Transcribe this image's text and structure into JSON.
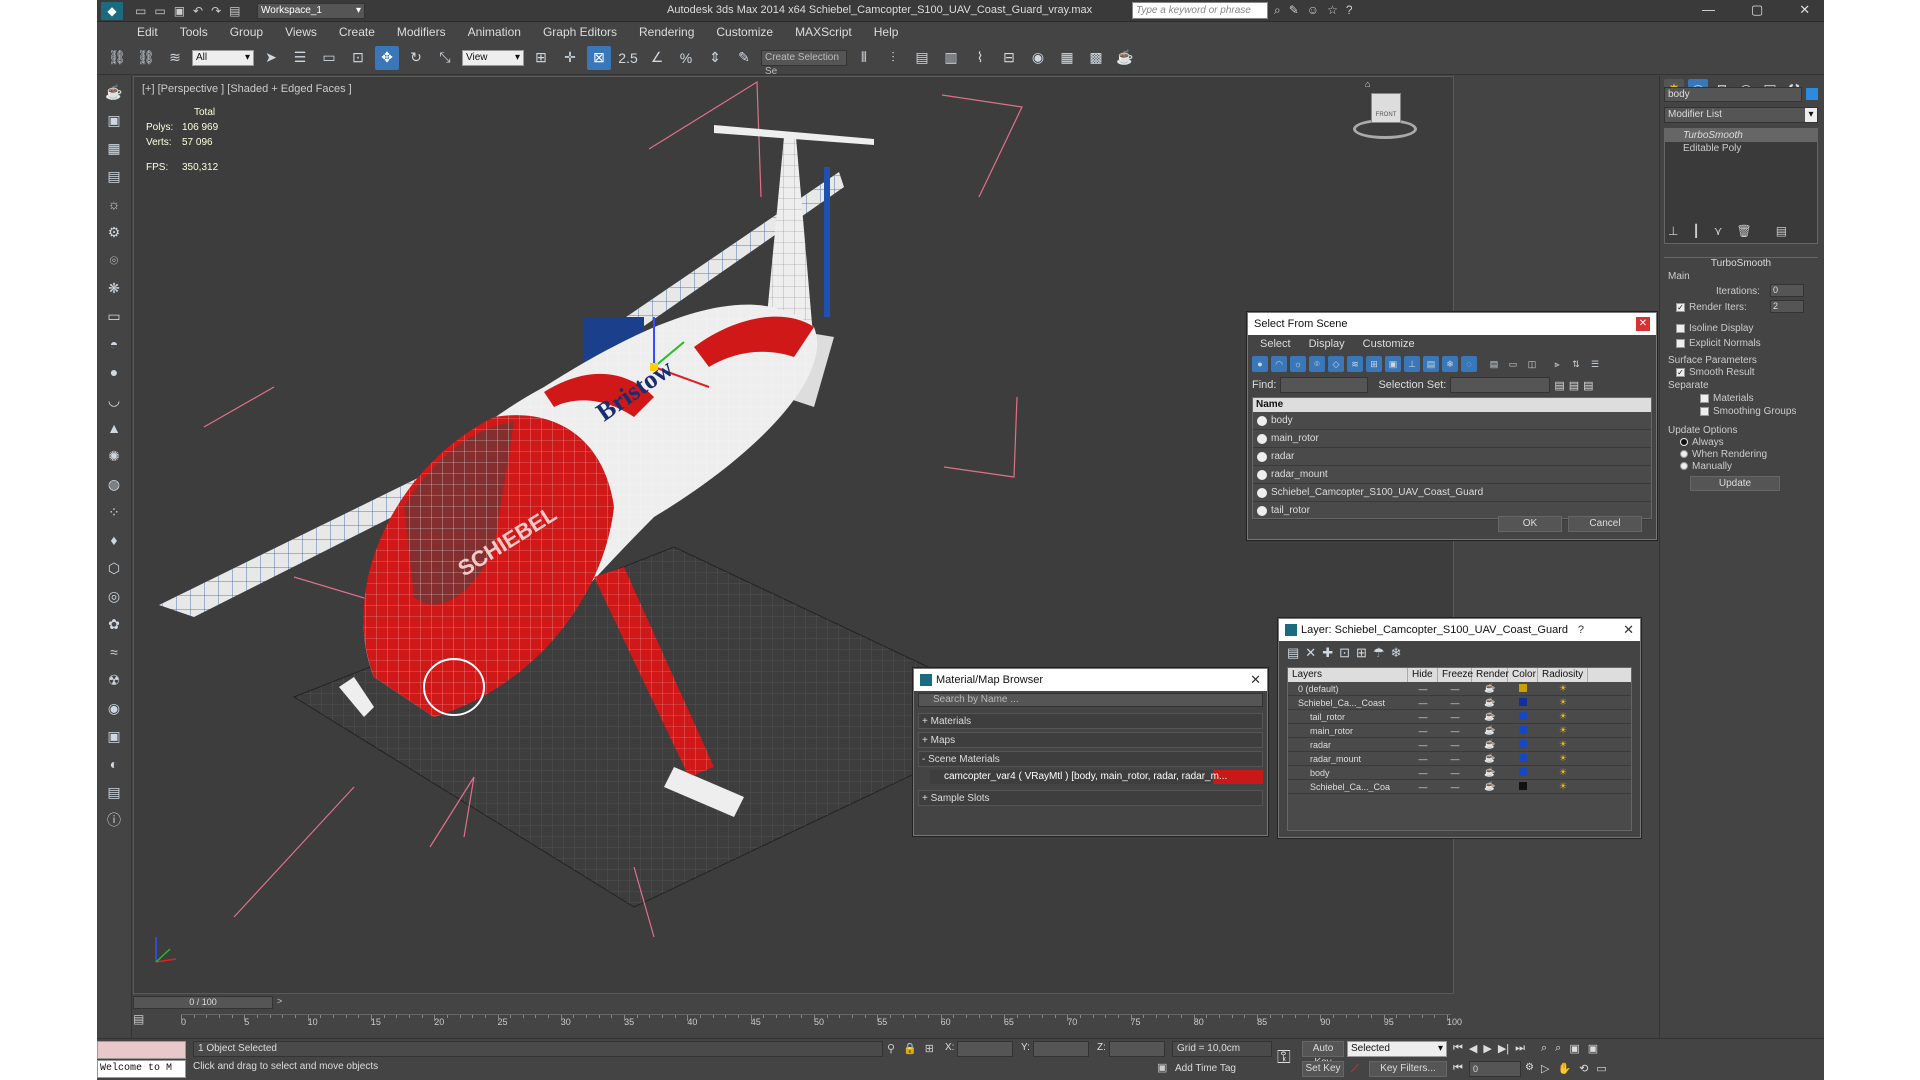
{
  "window": {
    "title": "Autodesk 3ds Max  2014 x64     Schiebel_Camcopter_S100_UAV_Coast_Guard_vray.max",
    "workspace": "Workspace_1",
    "search_placeholder": "Type a keyword or phrase"
  },
  "menu": [
    "Edit",
    "Tools",
    "Group",
    "Views",
    "Create",
    "Modifiers",
    "Animation",
    "Graph Editors",
    "Rendering",
    "Customize",
    "MAXScript",
    "Help"
  ],
  "toolbar": {
    "filter": "All",
    "refcoord": "View",
    "selection_set": "Create Selection Se"
  },
  "viewport": {
    "label": "[+] [Perspective ] [Shaded + Edged Faces ]",
    "stats": {
      "total_label": "Total",
      "polys_label": "Polys:",
      "polys": "106 969",
      "verts_label": "Verts:",
      "verts": "57 096",
      "fps_label": "FPS:",
      "fps": "350,312"
    },
    "logo_text": "Bristow",
    "brand_text": "SCHIEBEL",
    "viewcube_label": "FRONT"
  },
  "command_panel": {
    "object_name": "body",
    "modifier_list": "Modifier List",
    "stack": [
      "TurboSmooth",
      "Editable Poly"
    ],
    "rollout_title": "TurboSmooth",
    "main_label": "Main",
    "iterations_label": "Iterations:",
    "iterations": "0",
    "render_iters_label": "Render Iters:",
    "render_iters": "2",
    "isoline": "Isoline Display",
    "explicit": "Explicit Normals",
    "surface_params": "Surface Parameters",
    "smooth_result": "Smooth Result",
    "separate": "Separate",
    "materials": "Materials",
    "smoothing_groups": "Smoothing Groups",
    "update_options": "Update Options",
    "always": "Always",
    "when_rendering": "When Rendering",
    "manually": "Manually",
    "update_button": "Update"
  },
  "select_dialog": {
    "title": "Select From Scene",
    "tabs": [
      "Select",
      "Display",
      "Customize"
    ],
    "find_label": "Find:",
    "selset_label": "Selection Set:",
    "col_name": "Name",
    "items": [
      "body",
      "main_rotor",
      "radar",
      "radar_mount",
      "Schiebel_Camcopter_S100_UAV_Coast_Guard",
      "tail_rotor"
    ],
    "ok": "OK",
    "cancel": "Cancel"
  },
  "layer_dialog": {
    "title": "Layer: Schiebel_Camcopter_S100_UAV_Coast_Guard",
    "help": "?",
    "cols": [
      "Layers",
      "Hide",
      "Freeze",
      "Render",
      "Color",
      "Radiosity"
    ],
    "rows": [
      {
        "name": "0 (default)",
        "color": "#c8a000"
      },
      {
        "name": "Schiebel_Ca..._Coast",
        "color": "#1030a0"
      },
      {
        "name": "tail_rotor",
        "color": "#1848c0"
      },
      {
        "name": "main_rotor",
        "color": "#1848c0"
      },
      {
        "name": "radar",
        "color": "#1848c0"
      },
      {
        "name": "radar_mount",
        "color": "#1848c0"
      },
      {
        "name": "body",
        "color": "#1848c0"
      },
      {
        "name": "Schiebel_Ca..._Coa",
        "color": "#111111"
      }
    ]
  },
  "material_browser": {
    "title": "Material/Map Browser",
    "search_placeholder": "Search by Name ...",
    "sections": [
      "+ Materials",
      "+ Maps",
      "- Scene Materials",
      "+ Sample Slots"
    ],
    "scene_material": "camcopter_var4  ( VRayMtl ) [body, main_rotor, radar, radar_m..."
  },
  "timeline": {
    "frame": "0 / 100",
    "ticks": [
      "0",
      "5",
      "10",
      "15",
      "20",
      "25",
      "30",
      "35",
      "40",
      "45",
      "50",
      "55",
      "60",
      "65",
      "70",
      "75",
      "80",
      "85",
      "90",
      "95",
      "100"
    ]
  },
  "status": {
    "welcome": "Welcome to M",
    "selected": "1 Object Selected",
    "prompt": "Click and drag to select and move objects",
    "x_label": "X:",
    "y_label": "Y:",
    "z_label": "Z:",
    "grid": "Grid = 10,0cm",
    "add_time_tag": "Add Time Tag",
    "auto_key": "Auto Key",
    "set_key": "Set Key",
    "key_mode": "Selected",
    "key_filters": "Key Filters...",
    "frame_field": "0"
  }
}
